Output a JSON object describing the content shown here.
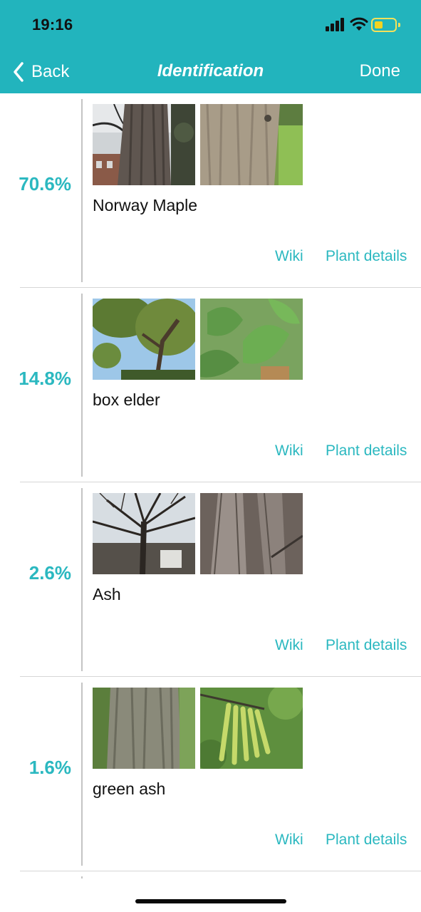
{
  "status_bar": {
    "time": "19:16"
  },
  "nav": {
    "back_label": "Back",
    "title": "Identification",
    "done_label": "Done"
  },
  "colors": {
    "accent": "#22b4bd",
    "percent": "#2bb8c0",
    "link": "#2bb8c0"
  },
  "results": [
    {
      "percent": "70.6%",
      "name": "Norway Maple",
      "wiki": "Wiki",
      "details": "Plant details"
    },
    {
      "percent": "14.8%",
      "name": "box elder",
      "wiki": "Wiki",
      "details": "Plant details"
    },
    {
      "percent": "2.6%",
      "name": "Ash",
      "wiki": "Wiki",
      "details": "Plant details"
    },
    {
      "percent": "1.6%",
      "name": "green ash",
      "wiki": "Wiki",
      "details": "Plant details"
    }
  ]
}
